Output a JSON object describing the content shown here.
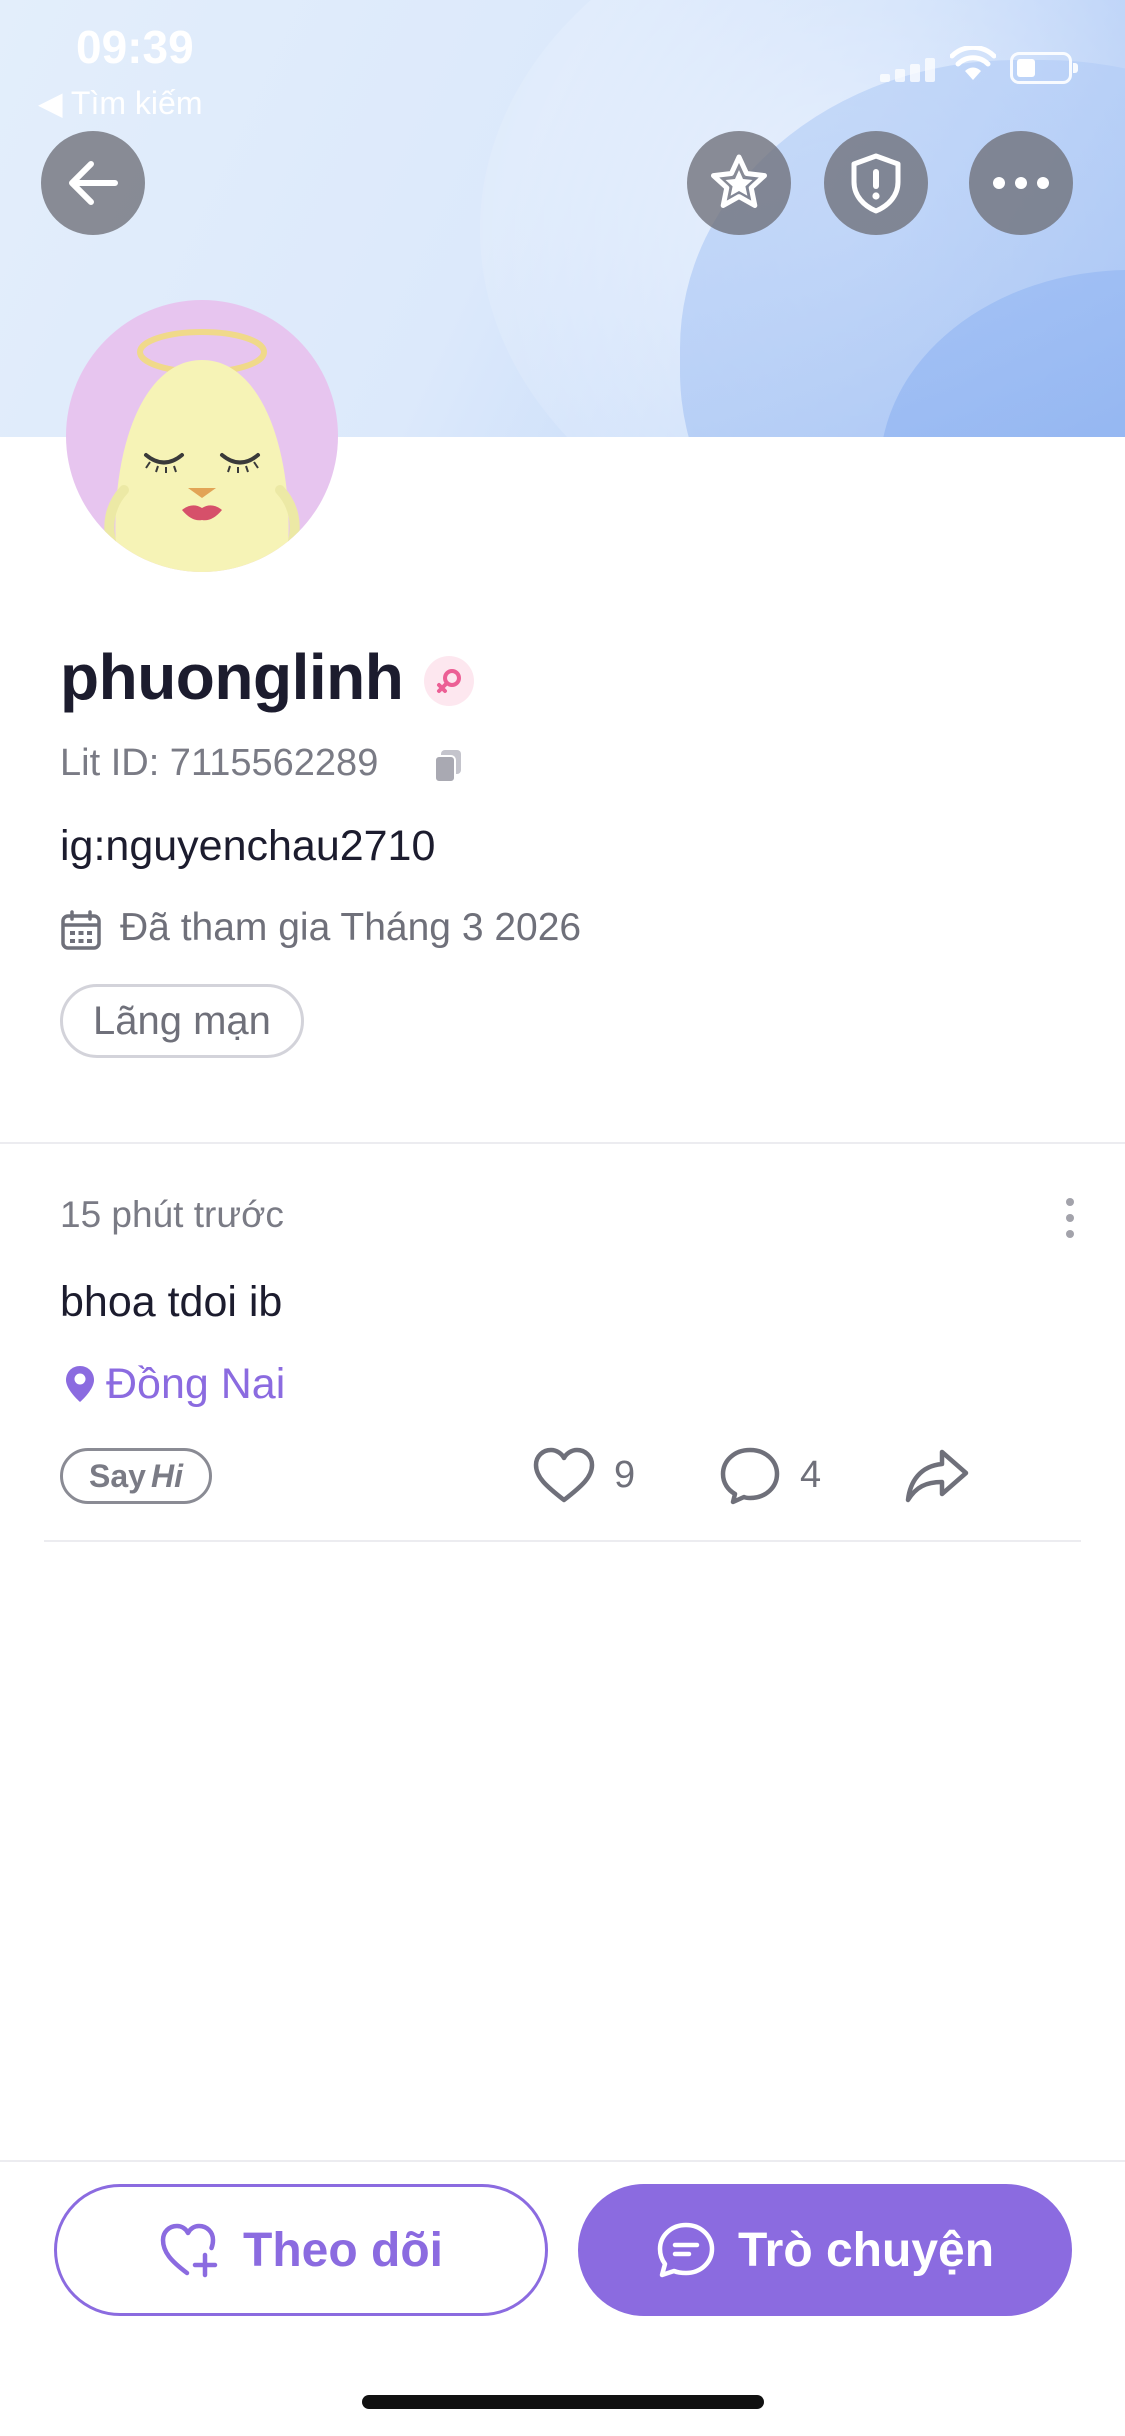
{
  "status_bar": {
    "time": "09:39",
    "back_app": "◀ Tìm kiếm"
  },
  "header": {
    "icons": [
      "back-arrow-icon",
      "star-icon",
      "shield-icon",
      "more-icon"
    ]
  },
  "profile": {
    "username": "phuonglinh",
    "gender_icon": "female-icon",
    "lit_id": "Lit ID: 7115562289",
    "bio": "ig:nguyenchau2710",
    "joined": "Đã tham gia Tháng 3 2026",
    "tags": [
      "Lãng mạn"
    ]
  },
  "post": {
    "time": "15 phút trước",
    "text": "bhoa tdoi ib",
    "location": "Đồng Nai",
    "sayhi_say": "Say",
    "sayhi_hi": "Hi",
    "likes": "9",
    "comments": "4"
  },
  "actions": {
    "follow_label": "Theo dõi",
    "chat_label": "Trò chuyện"
  },
  "colors": {
    "accent": "#8b6be0",
    "avatar_bg": "#e7c5ef",
    "text_primary": "#1c1c2e",
    "text_secondary": "#7a7b85"
  }
}
